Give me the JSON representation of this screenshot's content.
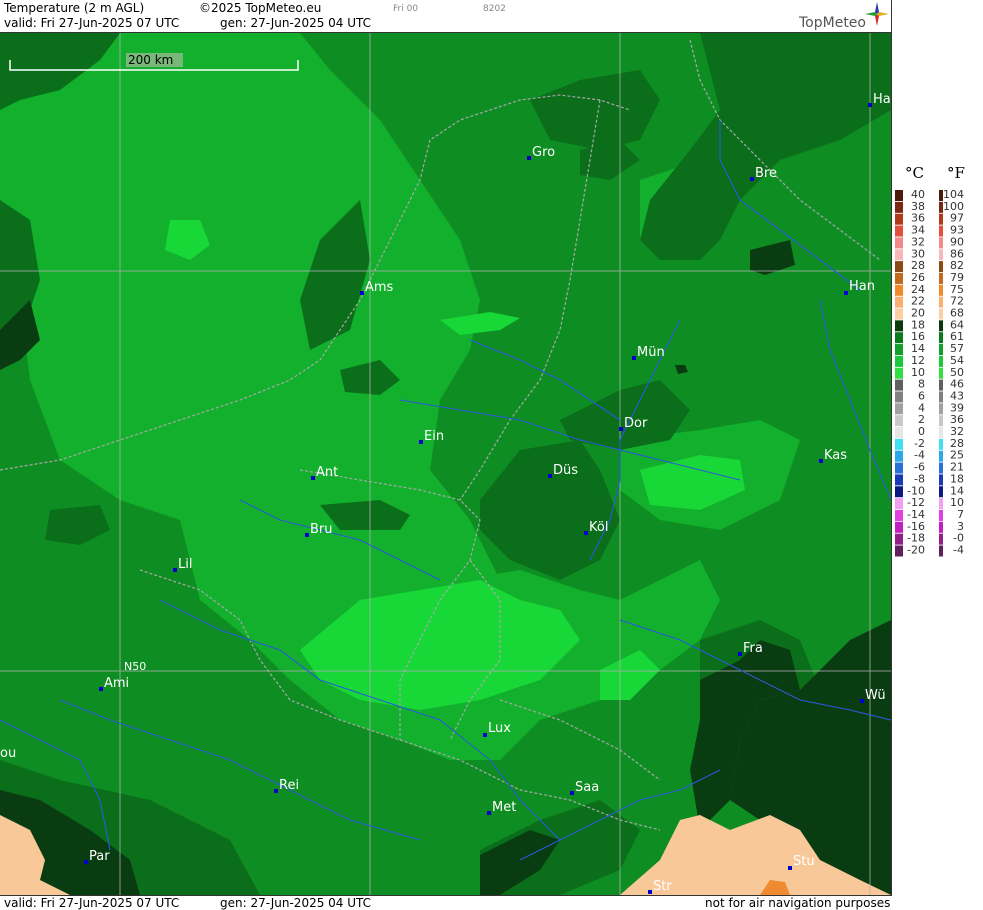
{
  "header": {
    "title": "Temperature (2 m AGL)",
    "copyright": "©2025 TopMeteo.eu",
    "small_1": "Fri 00",
    "small_2": "8202",
    "valid": "valid:  Fri  27-Jun-2025  07 UTC",
    "gen": "gen:  27-Jun-2025  04 UTC",
    "logo": "TopMeteo"
  },
  "footer": {
    "valid": "valid:  Fri  27-Jun-2025  07 UTC",
    "gen": "gen:  27-Jun-2025  04 UTC",
    "disclaimer": "not for air navigation purposes"
  },
  "map": {
    "scale_label": "200 km",
    "latitude_label": "N50",
    "cities": [
      {
        "label": "Ha"
      },
      {
        "label": "Gro"
      },
      {
        "label": "Bre"
      },
      {
        "label": "Ams"
      },
      {
        "label": "Han"
      },
      {
        "label": "Mün"
      },
      {
        "label": "Dor"
      },
      {
        "label": "Ein"
      },
      {
        "label": "Kas"
      },
      {
        "label": "Ant"
      },
      {
        "label": "Düs"
      },
      {
        "label": "Bru"
      },
      {
        "label": "Köl"
      },
      {
        "label": "Lil"
      },
      {
        "label": "Fra"
      },
      {
        "label": "Ami"
      },
      {
        "label": "Wü"
      },
      {
        "label": "ou"
      },
      {
        "label": "Lux"
      },
      {
        "label": "Rei"
      },
      {
        "label": "Saa"
      },
      {
        "label": "Met"
      },
      {
        "label": "Par"
      },
      {
        "label": "Stu"
      },
      {
        "label": "Str"
      }
    ]
  },
  "legend": {
    "celsius_header": "°C",
    "fahrenheit_header": "°F",
    "rows": [
      {
        "c": "40",
        "f": "104",
        "color": "#4a1a0a"
      },
      {
        "c": "38",
        "f": "100",
        "color": "#7a2a12"
      },
      {
        "c": "36",
        "f": "97",
        "color": "#b03a1a"
      },
      {
        "c": "34",
        "f": "93",
        "color": "#e0503a"
      },
      {
        "c": "32",
        "f": "90",
        "color": "#f08a8a"
      },
      {
        "c": "30",
        "f": "86",
        "color": "#f6b8b8"
      },
      {
        "c": "28",
        "f": "82",
        "color": "#8a4a14"
      },
      {
        "c": "26",
        "f": "79",
        "color": "#c06a1e"
      },
      {
        "c": "24",
        "f": "75",
        "color": "#f08a2a"
      },
      {
        "c": "22",
        "f": "72",
        "color": "#fab070"
      },
      {
        "c": "20",
        "f": "68",
        "color": "#fbcfa0"
      },
      {
        "c": "18",
        "f": "64",
        "color": "#0a3a0a"
      },
      {
        "c": "16",
        "f": "61",
        "color": "#0a7a1a"
      },
      {
        "c": "14",
        "f": "57",
        "color": "#12a02a"
      },
      {
        "c": "12",
        "f": "54",
        "color": "#1ac83a"
      },
      {
        "c": "10",
        "f": "50",
        "color": "#30e040"
      },
      {
        "c": "8",
        "f": "46",
        "color": "#606060"
      },
      {
        "c": "6",
        "f": "43",
        "color": "#808080"
      },
      {
        "c": "4",
        "f": "39",
        "color": "#a0a0a0"
      },
      {
        "c": "2",
        "f": "36",
        "color": "#c8c8c8"
      },
      {
        "c": "0",
        "f": "32",
        "color": "#e6e6e6"
      },
      {
        "c": "-2",
        "f": "28",
        "color": "#40e0f0"
      },
      {
        "c": "-4",
        "f": "25",
        "color": "#2aa8e8"
      },
      {
        "c": "-6",
        "f": "21",
        "color": "#2a70d8"
      },
      {
        "c": "-8",
        "f": "18",
        "color": "#1a3ab8"
      },
      {
        "c": "-10",
        "f": "14",
        "color": "#0a1a80"
      },
      {
        "c": "-12",
        "f": "10",
        "color": "#f0a0f0"
      },
      {
        "c": "-14",
        "f": "7",
        "color": "#e040e0"
      },
      {
        "c": "-16",
        "f": "3",
        "color": "#c020c0"
      },
      {
        "c": "-18",
        "f": "-0",
        "color": "#90208a"
      },
      {
        "c": "-20",
        "f": "-4",
        "color": "#602060"
      }
    ]
  },
  "colors": {
    "temp_10_12": "#18d838",
    "temp_12_14": "#12b02c",
    "temp_14_16": "#0e8e22",
    "temp_16_18": "#0a6e1a",
    "temp_18_20": "#0a3c12",
    "temp_20_22": "#f8c898",
    "temp_22_24": "#f08a30",
    "river": "#2a5ad8",
    "border": "#a0a0a0",
    "city_marker": "#0000cc"
  }
}
